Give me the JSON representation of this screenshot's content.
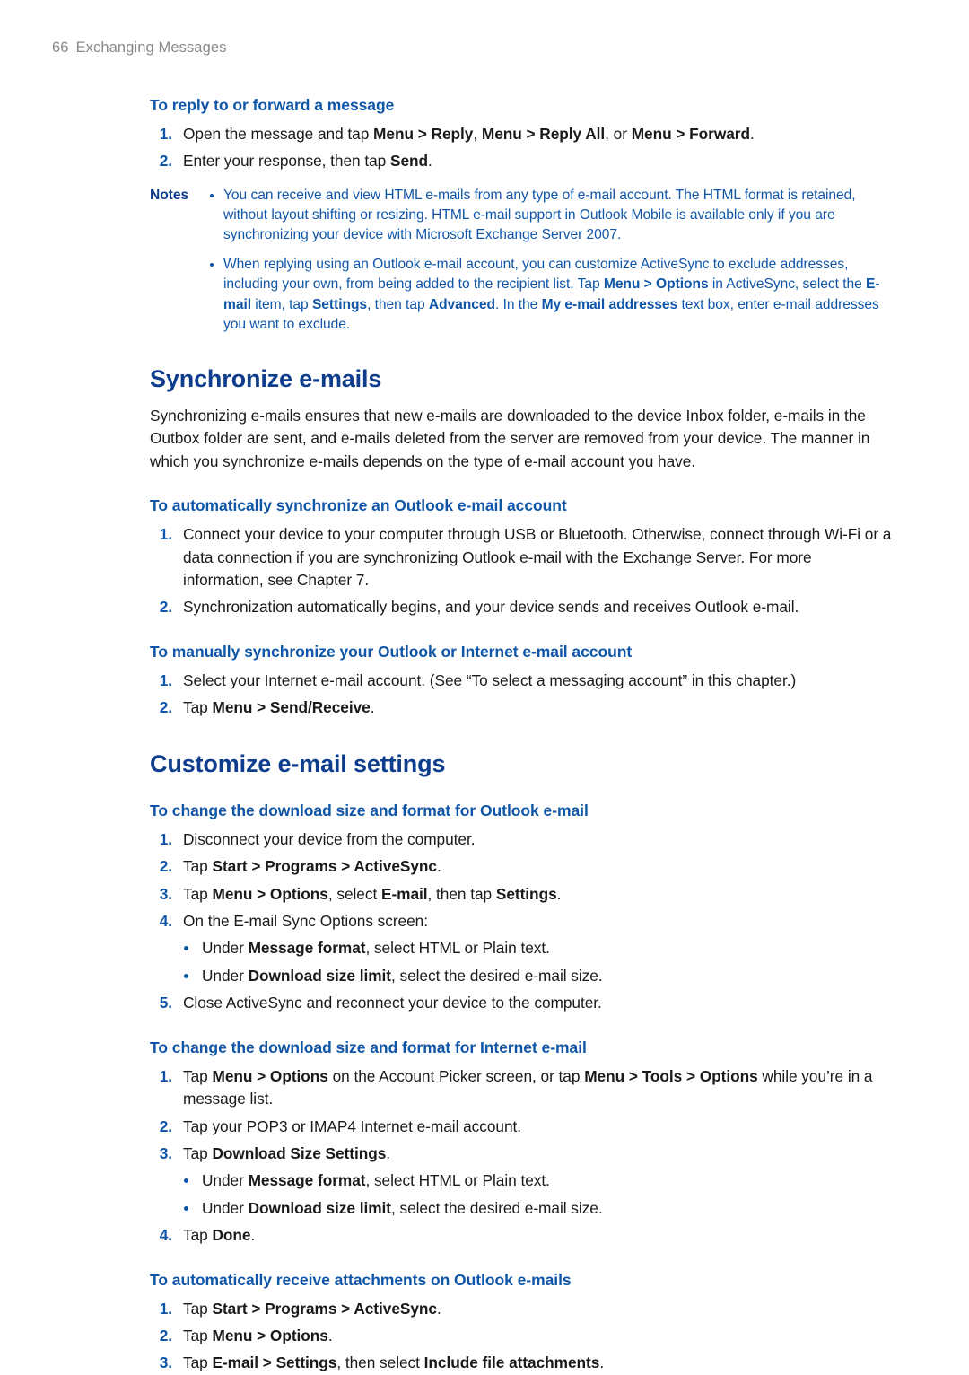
{
  "header": {
    "folio": "66",
    "chapter_title": "Exchanging Messages"
  },
  "colors": {
    "heading_primary": "#0d3d8c",
    "heading_secondary": "#1056a8",
    "body": "#1a1a1a",
    "running_header": "#8a8a8a",
    "marker": "#1056a8"
  },
  "sections": {
    "reply_forward": {
      "title": "To reply to or forward a message",
      "steps": [
        {
          "num": "1.",
          "html": "Open the message and tap <b>Menu &gt; Reply</b>, <b>Menu &gt; Reply All</b>, or <b>Menu &gt; Forward</b>."
        },
        {
          "num": "2.",
          "html": "Enter your response, then tap <b>Send</b>."
        }
      ]
    },
    "notes": {
      "label": "Notes",
      "items": [
        {
          "html": "You can receive and view HTML e-mails from any type of e-mail account. The HTML format is retained, without layout shifting or resizing. HTML e-mail support in Outlook Mobile is available only if you are synchronizing your device with Microsoft Exchange Server 2007."
        },
        {
          "html": "When replying using an Outlook e-mail account, you can customize ActiveSync to exclude addresses, including your own, from being added to the recipient list. Tap <b>Menu &gt; Options</b> in ActiveSync, select the <b>E-mail</b> item, tap <b>Settings</b>, then tap <b>Advanced</b>. In the <b>My e-mail addresses</b> text box, enter e-mail addresses you want to exclude."
        }
      ]
    },
    "synchronize_emails": {
      "title": "Synchronize e-mails",
      "intro": "Synchronizing e-mails ensures that new e-mails are downloaded to the device Inbox folder, e-mails in the Outbox folder are sent, and e-mails deleted from the server are removed from your device. The manner in which you synchronize e-mails depends on the type of e-mail account you have.",
      "auto_outlook": {
        "title": "To automatically synchronize an Outlook e-mail account",
        "steps": [
          {
            "num": "1.",
            "html": "Connect your device to your computer through USB or Bluetooth. Otherwise, connect through Wi-Fi or a data connection if you are synchronizing Outlook e-mail with the Exchange Server. For more information, see Chapter 7."
          },
          {
            "num": "2.",
            "html": "Synchronization automatically begins, and your device sends and receives Outlook e-mail."
          }
        ]
      },
      "manual_sync": {
        "title": "To manually synchronize your Outlook or Internet e-mail account",
        "steps": [
          {
            "num": "1.",
            "html": "Select your Internet e-mail account. (See “To select a messaging account” in this chapter.)"
          },
          {
            "num": "2.",
            "html": "Tap <b>Menu &gt; Send/Receive</b>."
          }
        ]
      }
    },
    "customize_email_settings": {
      "title": "Customize e-mail settings",
      "outlook_download": {
        "title": "To change the download size and format for Outlook e-mail",
        "steps": [
          {
            "num": "1.",
            "html": "Disconnect your device from the computer."
          },
          {
            "num": "2.",
            "html": "Tap <b>Start &gt; Programs &gt; ActiveSync</b>."
          },
          {
            "num": "3.",
            "html": "Tap <b>Menu &gt; Options</b>, select <b>E-mail</b>, then tap <b>Settings</b>."
          },
          {
            "num": "4.",
            "html": "On the E-mail Sync Options screen:"
          },
          {
            "num": "5.",
            "html": "Close ActiveSync and reconnect your device to the computer."
          }
        ],
        "bullets": [
          {
            "html": "Under <b>Message format</b>, select HTML or Plain text."
          },
          {
            "html": "Under <b>Download size limit</b>, select the desired e-mail size."
          }
        ]
      },
      "internet_download": {
        "title": "To change the download size and format for Internet e-mail",
        "steps": [
          {
            "num": "1.",
            "html": "Tap <b>Menu &gt; Options</b> on the Account Picker screen, or tap <b>Menu &gt; Tools &gt; Options</b> while you’re in a message list."
          },
          {
            "num": "2.",
            "html": "Tap your POP3 or IMAP4 Internet e-mail account."
          },
          {
            "num": "3.",
            "html": "Tap <b>Download Size Settings</b>."
          },
          {
            "num": "4.",
            "html": "Tap <b>Done</b>."
          }
        ],
        "bullets": [
          {
            "html": "Under <b>Message format</b>, select HTML or Plain text."
          },
          {
            "html": "Under <b>Download size limit</b>, select the desired e-mail size."
          }
        ]
      },
      "auto_attachments": {
        "title": "To automatically receive attachments on Outlook e-mails",
        "steps": [
          {
            "num": "1.",
            "html": "Tap <b>Start &gt; Programs &gt; ActiveSync</b>."
          },
          {
            "num": "2.",
            "html": "Tap <b>Menu &gt; Options</b>."
          },
          {
            "num": "3.",
            "html": "Tap <b>E-mail &gt; Settings</b>, then select <b>Include file attachments</b>."
          }
        ]
      }
    }
  }
}
